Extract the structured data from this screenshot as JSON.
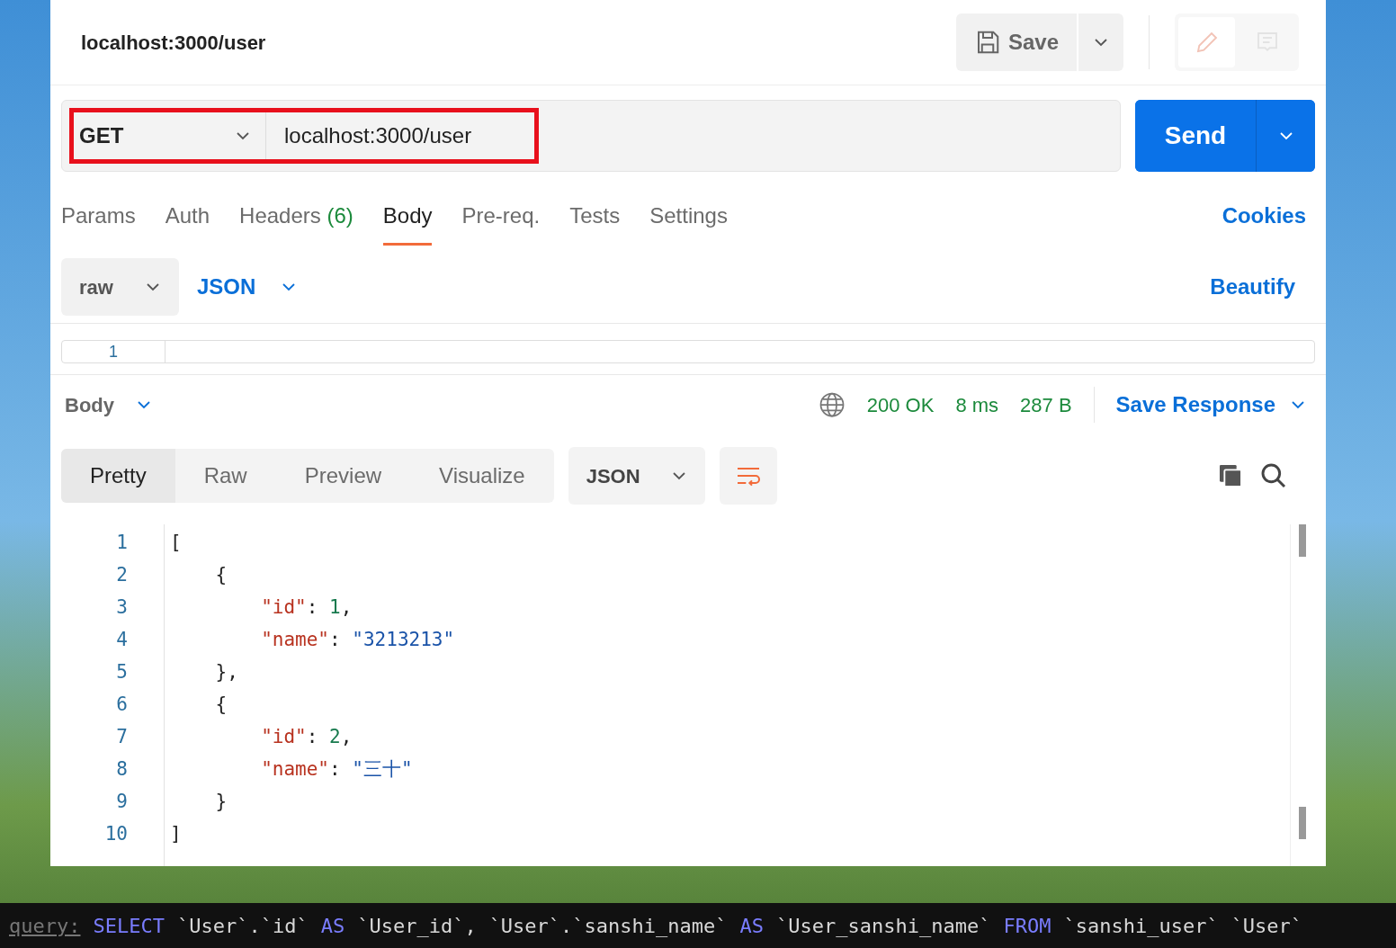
{
  "header": {
    "title": "localhost:3000/user",
    "save_label": "Save"
  },
  "request": {
    "method": "GET",
    "url": "localhost:3000/user",
    "highlighted": true,
    "send_label": "Send"
  },
  "tabs": [
    {
      "label": "Params",
      "selected": false
    },
    {
      "label": "Auth",
      "selected": false
    },
    {
      "label": "Headers",
      "count": "(6)",
      "selected": false
    },
    {
      "label": "Body",
      "selected": true
    },
    {
      "label": "Pre-req.",
      "selected": false
    },
    {
      "label": "Tests",
      "selected": false
    },
    {
      "label": "Settings",
      "selected": false
    }
  ],
  "cookies_link": "Cookies",
  "body_options": {
    "mode": "raw",
    "format": "JSON",
    "beautify": "Beautify"
  },
  "editor": {
    "line_numbers": [
      "1"
    ]
  },
  "response": {
    "section": "Body",
    "status": "200 OK",
    "time": "8 ms",
    "size": "287 B",
    "save_response": "Save Response",
    "view_tabs": [
      {
        "label": "Pretty",
        "selected": true
      },
      {
        "label": "Raw",
        "selected": false
      },
      {
        "label": "Preview",
        "selected": false
      },
      {
        "label": "Visualize",
        "selected": false
      }
    ],
    "format": "JSON",
    "lines": [
      {
        "number": "1",
        "tokens": [
          {
            "kind": "punct",
            "text": "["
          }
        ]
      },
      {
        "number": "2",
        "tokens": [
          {
            "kind": "punct",
            "text": "    {"
          }
        ]
      },
      {
        "number": "3",
        "tokens": [
          {
            "kind": "key",
            "text": "        \"id\""
          },
          {
            "kind": "punct",
            "text": ": "
          },
          {
            "kind": "number",
            "text": "1"
          },
          {
            "kind": "punct",
            "text": ","
          }
        ]
      },
      {
        "number": "4",
        "tokens": [
          {
            "kind": "key",
            "text": "        \"name\""
          },
          {
            "kind": "punct",
            "text": ": "
          },
          {
            "kind": "string",
            "text": "\"3213213\""
          }
        ]
      },
      {
        "number": "5",
        "tokens": [
          {
            "kind": "punct",
            "text": "    },"
          }
        ]
      },
      {
        "number": "6",
        "tokens": [
          {
            "kind": "punct",
            "text": "    {"
          }
        ]
      },
      {
        "number": "7",
        "tokens": [
          {
            "kind": "key",
            "text": "        \"id\""
          },
          {
            "kind": "punct",
            "text": ": "
          },
          {
            "kind": "number",
            "text": "2"
          },
          {
            "kind": "punct",
            "text": ","
          }
        ]
      },
      {
        "number": "8",
        "tokens": [
          {
            "kind": "key",
            "text": "        \"name\""
          },
          {
            "kind": "punct",
            "text": ": "
          },
          {
            "kind": "string",
            "text": "\"三十\""
          }
        ]
      },
      {
        "number": "9",
        "tokens": [
          {
            "kind": "punct",
            "text": "    }"
          }
        ]
      },
      {
        "number": "10",
        "tokens": [
          {
            "kind": "punct",
            "text": "]"
          }
        ]
      }
    ]
  },
  "terminal": {
    "tokens": [
      {
        "kind": "label",
        "text": "query:"
      },
      {
        "kind": "keyword",
        "text": "SELECT"
      },
      {
        "kind": "plain",
        "text": "`User`.`id`"
      },
      {
        "kind": "keyword",
        "text": "AS"
      },
      {
        "kind": "plain",
        "text": "`User_id`,"
      },
      {
        "kind": "plain",
        "text": "`User`.`sanshi_name`"
      },
      {
        "kind": "keyword",
        "text": "AS"
      },
      {
        "kind": "plain",
        "text": "`User_sanshi_name`"
      },
      {
        "kind": "keyword",
        "text": "FROM"
      },
      {
        "kind": "plain",
        "text": "`sanshi_user`"
      },
      {
        "kind": "plain",
        "text": "`User`"
      }
    ]
  }
}
